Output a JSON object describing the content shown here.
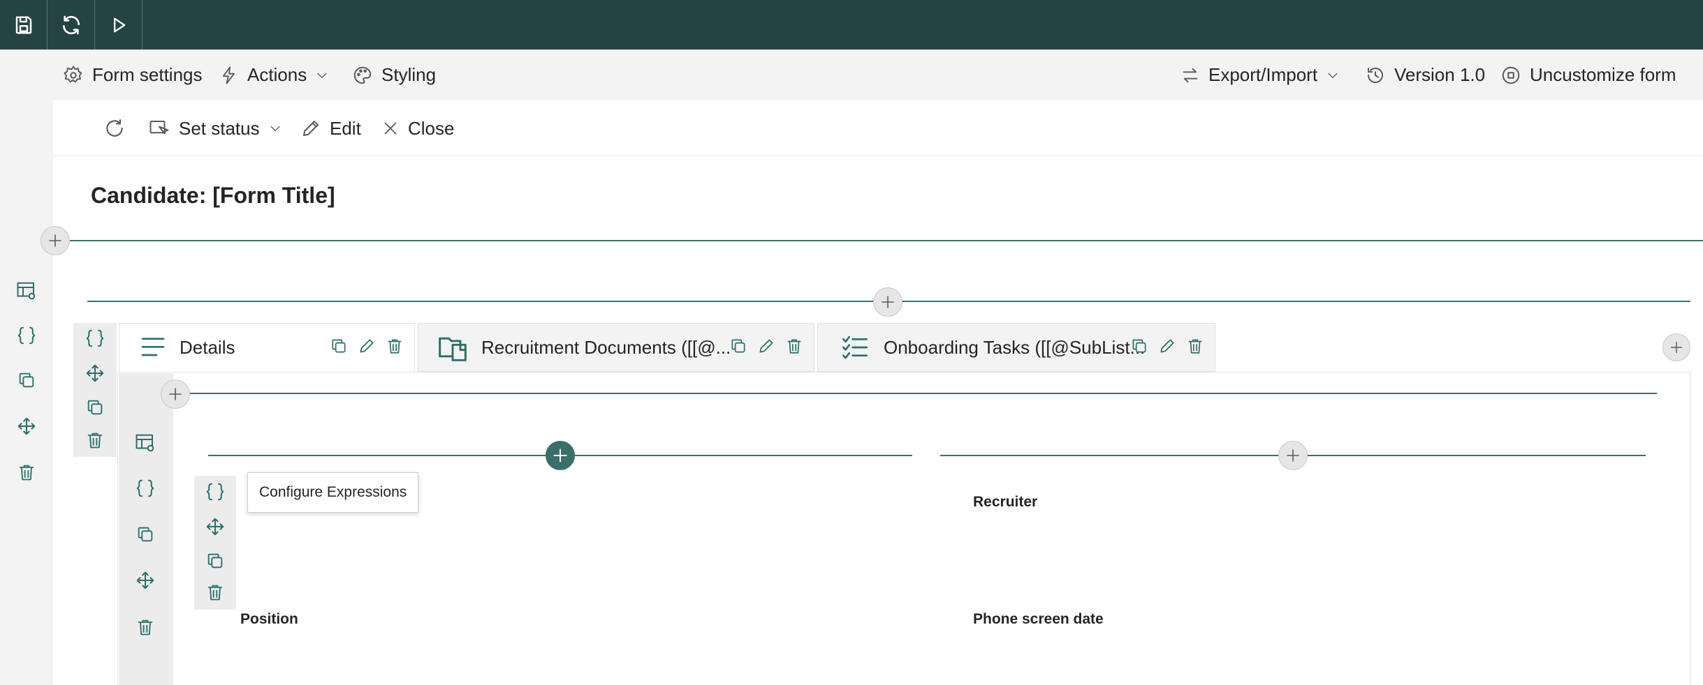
{
  "toolbar": {
    "save_icon": "save-icon",
    "refresh_icon": "refresh-icon",
    "run_icon": "play-icon"
  },
  "command_bar": {
    "form_settings": "Form settings",
    "actions": "Actions",
    "styling": "Styling",
    "export_import": "Export/Import",
    "version": "Version 1.0",
    "uncustomize": "Uncustomize form"
  },
  "form_bar": {
    "set_status": "Set status",
    "edit": "Edit",
    "close": "Close"
  },
  "form": {
    "title": "Candidate: [Form Title]"
  },
  "tabs": [
    {
      "label": "Details",
      "icon": "lines-icon"
    },
    {
      "label": "Recruitment Documents ([[@...",
      "icon": "documents-icon"
    },
    {
      "label": "Onboarding Tasks ([[@SubList...",
      "icon": "checklist-icon"
    }
  ],
  "tooltip": {
    "text": "Configure Expressions"
  },
  "fields": {
    "left_top": "",
    "right_top": "Recruiter",
    "left_bottom": "Position",
    "right_bottom": "Phone screen date"
  },
  "colors": {
    "top_bar": "#264344",
    "accent": "#3a6e69"
  }
}
